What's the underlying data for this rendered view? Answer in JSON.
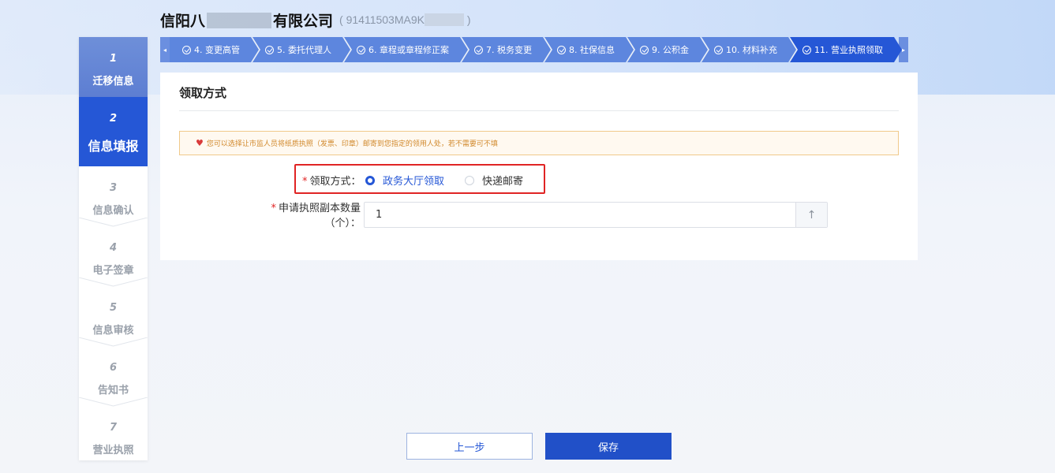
{
  "header": {
    "company_prefix": "信阳八",
    "company_suffix": "有限公司",
    "credit_code_open": "( 91411503MA9K",
    "credit_code_close": " )"
  },
  "stepper": {
    "steps": [
      {
        "num": "1",
        "label": "迁移信息",
        "state": "done"
      },
      {
        "num": "2",
        "label": "信息填报",
        "state": "active"
      },
      {
        "num": "3",
        "label": "信息确认",
        "state": "todo"
      },
      {
        "num": "4",
        "label": "电子签章",
        "state": "todo"
      },
      {
        "num": "5",
        "label": "信息审核",
        "state": "todo"
      },
      {
        "num": "6",
        "label": "告知书",
        "state": "todo"
      },
      {
        "num": "7",
        "label": "营业执照",
        "state": "todo"
      }
    ]
  },
  "tabs": {
    "left_arrow": "◂",
    "right_arrow": "▸",
    "items": [
      {
        "label": "4. 变更高管"
      },
      {
        "label": "5. 委托代理人"
      },
      {
        "label": "6. 章程或章程修正案"
      },
      {
        "label": "7. 税务变更"
      },
      {
        "label": "8. 社保信息"
      },
      {
        "label": "9. 公积金"
      },
      {
        "label": "10. 材料补充"
      },
      {
        "label": "11. 营业执照领取"
      }
    ]
  },
  "card": {
    "title": "领取方式",
    "notice": "您可以选择让市监人员将纸质执照（发票、印章）邮寄到您指定的领用人处，若不需要可不填",
    "pickup_label": "领取方式：",
    "pickup_options": [
      "政务大厅领取",
      "快递邮寄"
    ],
    "pickup_selected": "政务大厅领取",
    "copies_label_line1": "申请执照副本数量",
    "copies_label_line2": "（个）：",
    "copies_value": "1",
    "required_mark": "*"
  },
  "buttons": {
    "prev": "上一步",
    "save": "保存"
  },
  "colors": {
    "primary": "#2557d6",
    "tab_done": "#5d86de",
    "required": "#e02424",
    "notice_text": "#d1892c"
  }
}
